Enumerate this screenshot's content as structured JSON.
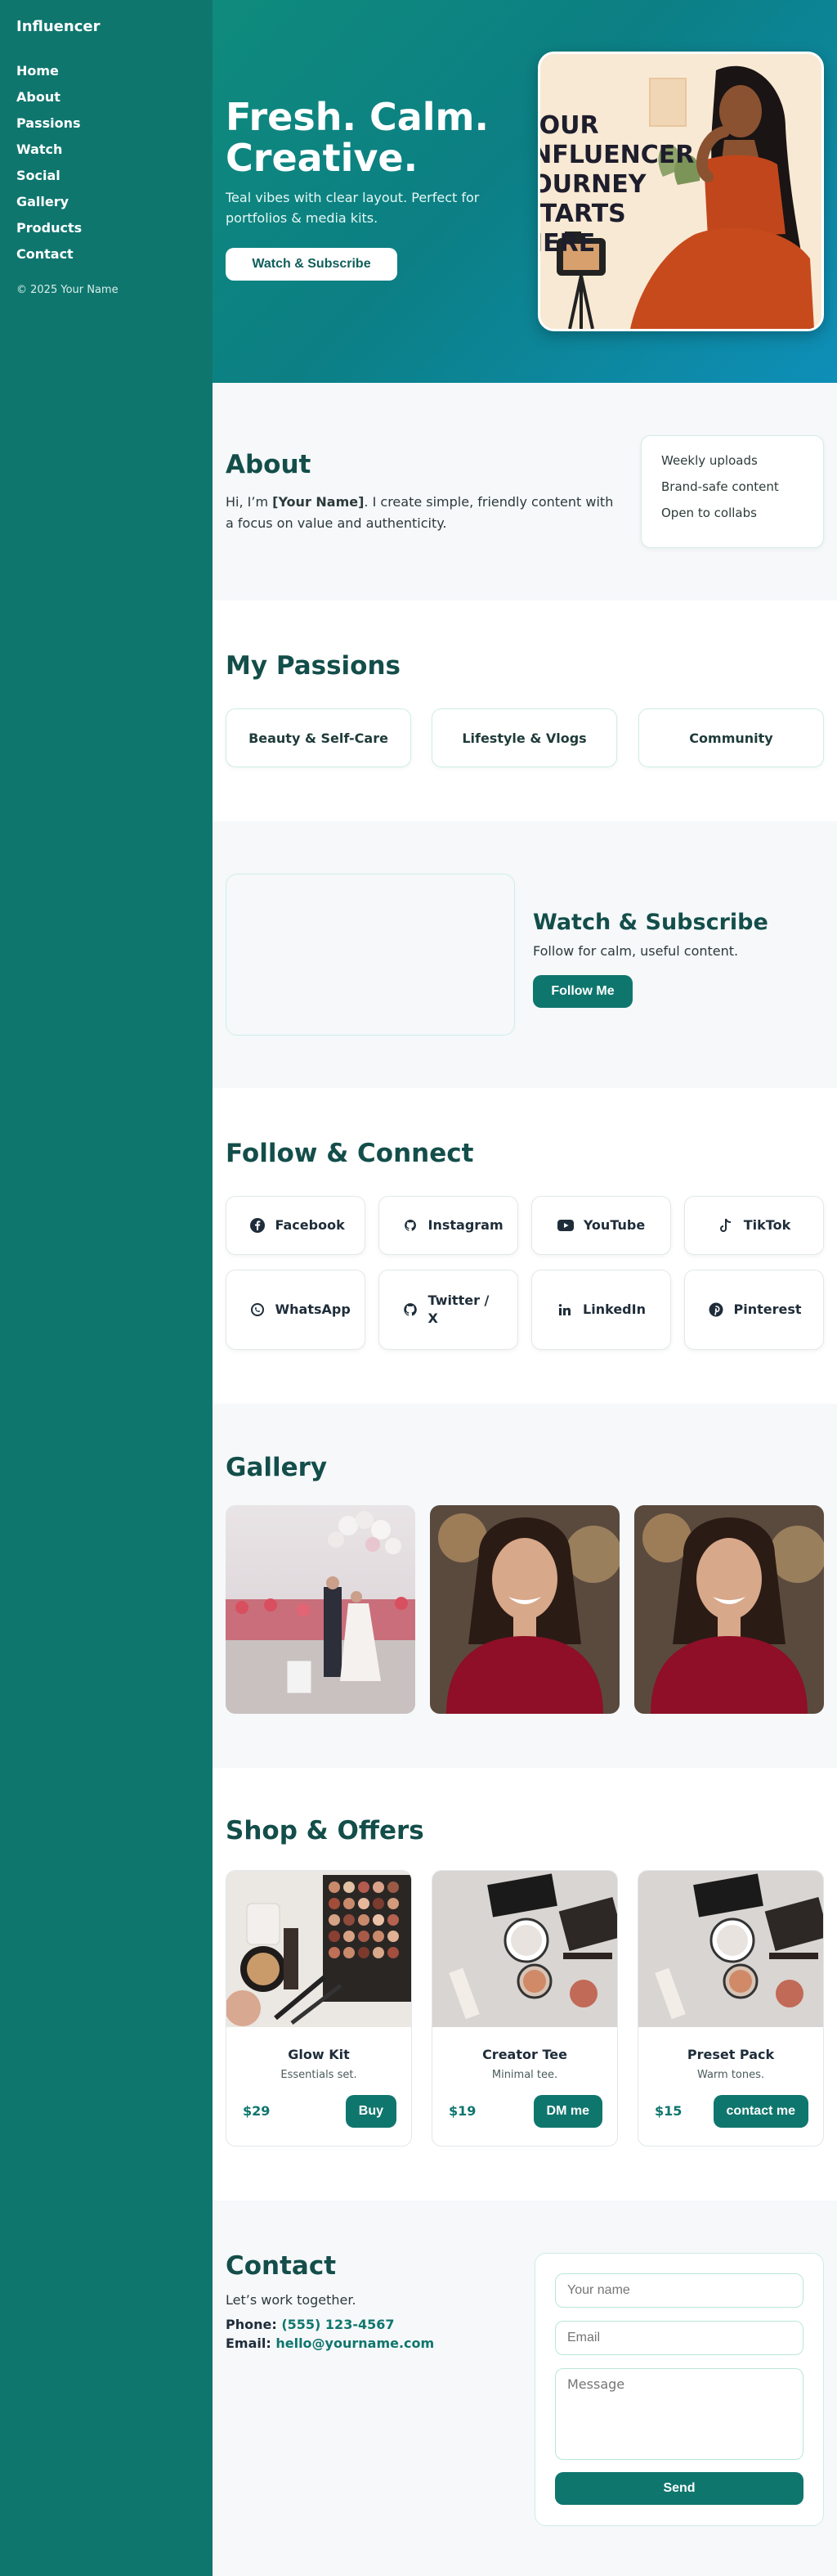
{
  "sidebar": {
    "brand": "Influencer",
    "nav": [
      "Home",
      "About",
      "Passions",
      "Watch",
      "Social",
      "Gallery",
      "Products",
      "Contact"
    ],
    "copyright": "© 2025 Your Name"
  },
  "hero": {
    "title": "Fresh. Calm. Creative.",
    "subtitle": "Teal vibes with clear layout. Perfect for portfolios & media kits.",
    "button": "Watch & Subscribe",
    "image_text": "YOUR INFLUENCER JOURNEY STARTS HERE"
  },
  "about": {
    "title": "About",
    "text_prefix": "Hi, I’m ",
    "name": "[Your Name]",
    "text_suffix": ". I create simple, friendly content with a focus on value and authenticity.",
    "highlights": [
      "Weekly uploads",
      "Brand-safe content",
      "Open to collabs"
    ]
  },
  "passions": {
    "title": "My Passions",
    "items": [
      "Beauty & Self-Care",
      "Lifestyle & Vlogs",
      "Community"
    ]
  },
  "watch": {
    "title": "Watch & Subscribe",
    "subtitle": "Follow for calm, useful content.",
    "button": "Follow Me"
  },
  "social": {
    "title": "Follow & Connect",
    "items": [
      {
        "label": "Facebook",
        "icon": "facebook-icon"
      },
      {
        "label": "Instagram",
        "icon": "instagram-icon"
      },
      {
        "label": "YouTube",
        "icon": "youtube-icon"
      },
      {
        "label": "TikTok",
        "icon": "tiktok-icon"
      },
      {
        "label": "WhatsApp",
        "icon": "whatsapp-icon"
      },
      {
        "label": "Twitter / X",
        "icon": "github-icon"
      },
      {
        "label": "LinkedIn",
        "icon": "linkedin-icon"
      },
      {
        "label": "Pinterest",
        "icon": "pinterest-icon"
      }
    ]
  },
  "gallery": {
    "title": "Gallery"
  },
  "shop": {
    "title": "Shop & Offers",
    "products": [
      {
        "name": "Glow Kit",
        "desc": "Essentials set.",
        "price": "$29",
        "button": "Buy"
      },
      {
        "name": "Creator Tee",
        "desc": "Minimal tee.",
        "price": "$19",
        "button": "DM me"
      },
      {
        "name": "Preset Pack",
        "desc": "Warm tones.",
        "price": "$15",
        "button": "contact me"
      }
    ]
  },
  "contact": {
    "title": "Contact",
    "subtitle": "Let’s work together.",
    "phone_label": "Phone:",
    "phone": "(555) 123-4567",
    "email_label": "Email:",
    "email": "hello@yourname.com",
    "form": {
      "name_placeholder": "Your name",
      "email_placeholder": "Email",
      "message_placeholder": "Message",
      "button": "Send"
    }
  },
  "colors": {
    "primary": "#0f766e",
    "heading": "#134e4a",
    "section_bg": "#f6f8fa"
  }
}
